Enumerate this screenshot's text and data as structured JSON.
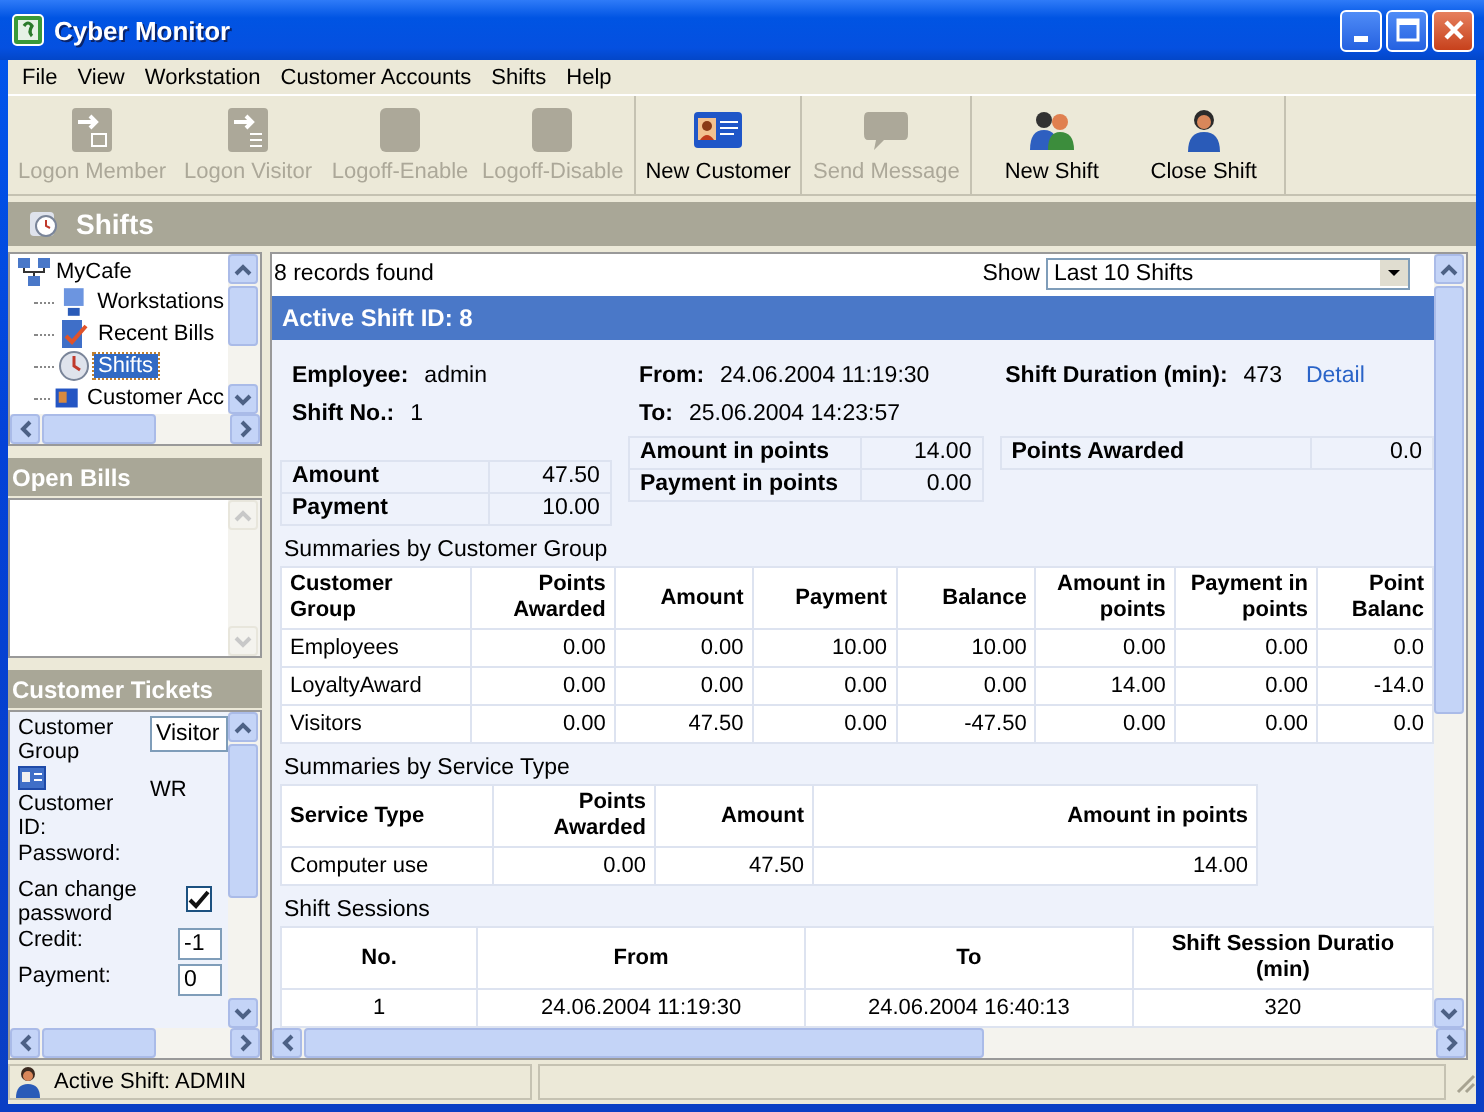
{
  "window": {
    "title": "Cyber Monitor"
  },
  "menu": [
    "File",
    "View",
    "Workstation",
    "Customer Accounts",
    "Shifts",
    "Help"
  ],
  "toolbar": [
    [
      {
        "label": "Logon Member",
        "kind": "arrow-card",
        "disabled": true
      },
      {
        "label": "Logon Visitor",
        "kind": "arrow-list",
        "disabled": true
      },
      {
        "label": "Logoff-Enable",
        "kind": "blank",
        "disabled": true
      },
      {
        "label": "Logoff-Disable",
        "kind": "blank",
        "disabled": true
      }
    ],
    [
      {
        "label": "New Customer",
        "kind": "id-card",
        "disabled": false
      }
    ],
    [
      {
        "label": "Send Message",
        "kind": "speech",
        "disabled": true
      }
    ],
    [
      {
        "label": "New Shift",
        "kind": "two-people",
        "disabled": false
      },
      {
        "label": "Close Shift",
        "kind": "person",
        "disabled": false
      }
    ]
  ],
  "section_header": {
    "title": "Shifts"
  },
  "tree": {
    "label": "MyCafe",
    "children": [
      {
        "label": "Workstations",
        "kind": "monitor",
        "selected": false
      },
      {
        "label": "Recent Bills",
        "kind": "bill",
        "selected": false
      },
      {
        "label": "Shifts",
        "kind": "clock",
        "selected": true
      },
      {
        "label": "Customer Acc",
        "kind": "card",
        "selected": false
      }
    ]
  },
  "open_bills": {
    "title": "Open Bills"
  },
  "customer_tickets": {
    "title": "Customer Tickets",
    "fields": [
      {
        "label": "Customer Group",
        "kind": "select",
        "value": "Visitor"
      },
      {
        "label": "Customer ID:",
        "kind": "text",
        "value": "WR"
      },
      {
        "label": "Password:",
        "kind": "empty"
      },
      {
        "label": "Can change password",
        "kind": "checkbox",
        "checked": true
      },
      {
        "label": "Credit:",
        "kind": "input",
        "value": "-1"
      },
      {
        "label": "Payment:",
        "kind": "input",
        "value": "0"
      }
    ]
  },
  "records": {
    "count": "8 records found",
    "show_label": "Show",
    "show_value": "Last 10 Shifts"
  },
  "shift": {
    "title": "Active Shift ID: 8",
    "columns": [
      [
        {
          "label": "Employee:",
          "value": "admin"
        },
        {
          "label": "Shift No.:",
          "value": "1"
        }
      ],
      [
        {
          "label": "From:",
          "value": "24.06.2004 11:19:30"
        },
        {
          "label": "To:",
          "value": "25.06.2004 14:23:57"
        }
      ],
      [
        {
          "label": "Shift Duration (min):",
          "value": "473"
        }
      ]
    ],
    "link": "Detail",
    "totals": [
      [
        {
          "label": "Amount",
          "value": "47.50"
        },
        {
          "label": "Payment",
          "value": "10.00"
        }
      ],
      [
        {
          "label": "Amount in points",
          "value": "14.00"
        },
        {
          "label": "Payment in points",
          "value": "0.00"
        }
      ],
      [
        {
          "label": "Points Awarded",
          "value": "0.0"
        }
      ]
    ]
  },
  "tables": [
    {
      "title": "Summaries by Customer Group",
      "columns": [
        "Customer Group",
        "Points Awarded",
        "Amount",
        "Payment",
        "Balance",
        "Amount in points",
        "Payment in points",
        "Point Balanc"
      ],
      "rows": [
        [
          "Employees",
          "0.00",
          "0.00",
          "10.00",
          "10.00",
          "0.00",
          "0.00",
          "0.0"
        ],
        [
          "LoyaltyAward",
          "0.00",
          "0.00",
          "0.00",
          "0.00",
          "14.00",
          "0.00",
          "-14.0"
        ],
        [
          "Visitors",
          "0.00",
          "47.50",
          "0.00",
          "-47.50",
          "0.00",
          "0.00",
          "0.0"
        ]
      ]
    },
    {
      "title": "Summaries by Service Type",
      "columns": [
        "Service Type",
        "Points Awarded",
        "Amount",
        "Amount in points"
      ],
      "rows": [
        [
          "Computer use",
          "0.00",
          "47.50",
          "14.00"
        ]
      ]
    },
    {
      "title": "Shift Sessions",
      "columns": [
        "No.",
        "From",
        "To",
        "Shift Session Duratio (min)"
      ],
      "rows": [
        [
          "1",
          "24.06.2004 11:19:30",
          "24.06.2004 16:40:13",
          "320"
        ]
      ]
    }
  ],
  "status_bar": {
    "text": "Active Shift: ADMIN"
  }
}
